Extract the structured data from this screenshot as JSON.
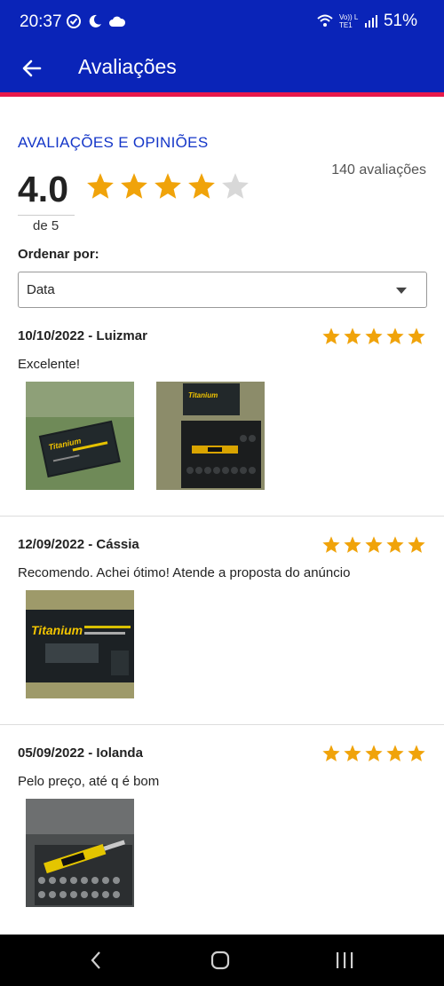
{
  "status_bar": {
    "time": "20:37",
    "battery": "51%",
    "network_label": "Vo)) LTE1"
  },
  "app_bar": {
    "title": "Avaliações",
    "back_icon": "arrow-left-icon"
  },
  "summary": {
    "section_title": "AVALIAÇÕES E OPINIÕES",
    "average": "4.0",
    "out_of": "de 5",
    "stars_filled": 4,
    "stars_total": 5,
    "review_count": "140 avaliações"
  },
  "sort": {
    "label": "Ordenar por:",
    "selected": "Data"
  },
  "reviews": [
    {
      "header": "10/10/2022 - Luizmar",
      "stars": 5,
      "text": "Excelente!",
      "photo_count": 2
    },
    {
      "header": "12/09/2022 - Cássia",
      "stars": 5,
      "text": "Recomendo. Achei ótimo! Atende a proposta do anúncio",
      "photo_count": 1
    },
    {
      "header": "05/09/2022 - Iolanda",
      "stars": 5,
      "text": "Pelo preço, até q é bom",
      "photo_count": 1
    }
  ],
  "photo_logo_text": "Titanium",
  "colors": {
    "primary": "#0a24b8",
    "accent": "#e8194b",
    "title_blue": "#1436c8",
    "star": "#f0a30a",
    "star_empty": "#d8d8d8"
  }
}
